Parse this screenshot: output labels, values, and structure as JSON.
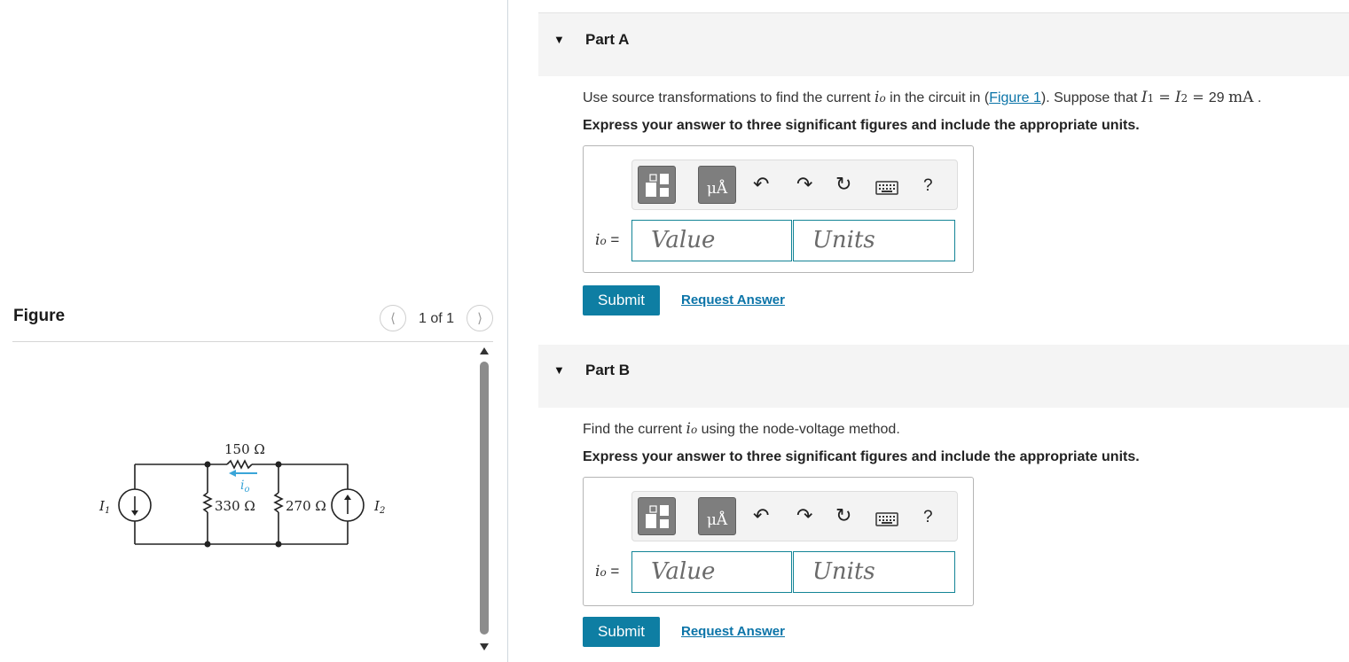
{
  "figure_panel": {
    "title": "Figure",
    "pager": "1 of 1",
    "prev_icon": "chevron-left-icon",
    "next_icon": "chevron-right-icon",
    "circuit": {
      "source1_label": "I",
      "source1_sub": "1",
      "source2_label": "I",
      "source2_sub": "2",
      "r_top": "150 Ω",
      "r_left": "330 Ω",
      "r_right": "270 Ω",
      "current_label": "i",
      "current_sub": "o",
      "current_arrow_color": "#3aa5d8"
    }
  },
  "part_a": {
    "label": "Part A",
    "prompt_pre": "Use source transformations to find the current ",
    "var": "i",
    "var_sub": "o",
    "prompt_mid": " in the circuit in (",
    "figure_link": "Figure 1",
    "prompt_post": "). Suppose that ",
    "eq_i1": "I",
    "eq_i1_sub": "1",
    "eq_i2": "I",
    "eq_i2_sub": "2",
    "eq_value": "29",
    "eq_unit": "mA",
    "instruction": "Express your answer to three significant figures and include the appropriate units.",
    "value_placeholder": "Value",
    "units_placeholder": "Units",
    "submit_label": "Submit",
    "request_label": "Request Answer"
  },
  "part_b": {
    "label": "Part B",
    "prompt_pre": "Find the current ",
    "var": "i",
    "var_sub": "o",
    "prompt_post": " using the node-voltage method.",
    "instruction": "Express your answer to three significant figures and include the appropriate units.",
    "value_placeholder": "Value",
    "units_placeholder": "Units",
    "submit_label": "Submit",
    "request_label": "Request Answer"
  },
  "toolbar": {
    "units_btn_label": "μÅ",
    "help_label": "?",
    "icons": [
      "templates-icon",
      "units-icon",
      "undo-icon",
      "redo-icon",
      "reset-icon",
      "keyboard-icon",
      "help-icon"
    ]
  },
  "colors": {
    "accent": "#0e7ea3",
    "link": "#0b74a8",
    "field_border": "#138496",
    "header_bg": "#f4f4f4"
  }
}
